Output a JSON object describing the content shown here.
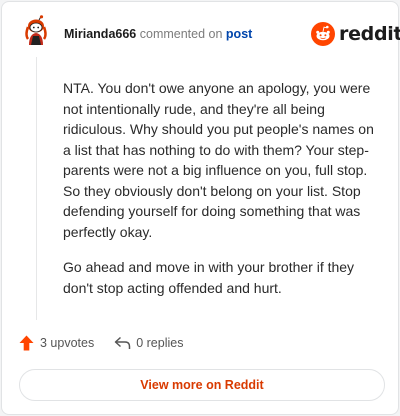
{
  "header": {
    "username": "Mirianda666",
    "action": "commented on",
    "post_link": "post"
  },
  "logo": {
    "text": "reddit",
    "color": "#ff4500"
  },
  "comment": {
    "paragraphs": [
      "NTA. You don't owe anyone an apology, you were not intentionally rude, and they're all being ridiculous. Why should you put people's names on a list that has nothing to do with them? Your step-parents were not a big influence on you, full stop. So they obviously don't belong on your list. Stop defending yourself for doing something that was perfectly okay.",
      "Go ahead and move in with your brother if they don't stop acting offended and hurt."
    ]
  },
  "footer": {
    "upvotes": "3 upvotes",
    "replies": "0 replies"
  },
  "view_more": "View more on Reddit",
  "colors": {
    "accent": "#d93a00",
    "upvote": "#ff4500",
    "link": "#0045ac"
  }
}
